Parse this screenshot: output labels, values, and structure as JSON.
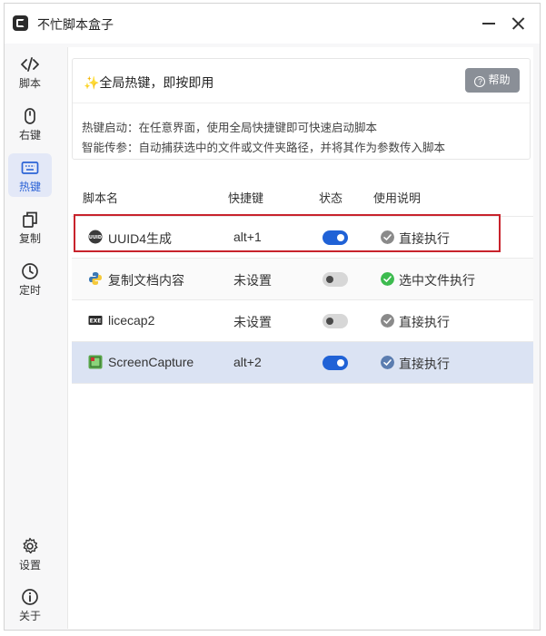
{
  "window": {
    "title": "不忙脚本盒子"
  },
  "sidebar": {
    "items": [
      {
        "label": "脚本",
        "icon": "code-icon"
      },
      {
        "label": "右键",
        "icon": "mouse-icon"
      },
      {
        "label": "热键",
        "icon": "keyboard-icon",
        "active": true
      },
      {
        "label": "复制",
        "icon": "copy-icon"
      },
      {
        "label": "定时",
        "icon": "clock-icon"
      }
    ],
    "bottom": [
      {
        "label": "设置",
        "icon": "gear-icon"
      },
      {
        "label": "关于",
        "icon": "info-icon"
      }
    ]
  },
  "info": {
    "title": "✨全局热键，即按即用",
    "help_label": "帮助",
    "line1": "热键启动：在任意界面，使用全局快捷键即可快速启动脚本",
    "line2": "智能传参：自动捕获选中的文件或文件夹路径，并将其作为参数传入脚本"
  },
  "table": {
    "headers": [
      "脚本名",
      "快捷键",
      "状态",
      "使用说明"
    ],
    "rows": [
      {
        "name": "UUID4生成",
        "hotkey": "alt+1",
        "enabled": true,
        "usage": "直接执行",
        "icon": "uuid-icon",
        "usage_color": "#8a8a8a"
      },
      {
        "name": "复制文档内容",
        "hotkey": "未设置",
        "enabled": false,
        "usage": "选中文件执行",
        "icon": "python-icon",
        "usage_color": "#3dbb4f"
      },
      {
        "name": "licecap2",
        "hotkey": "未设置",
        "enabled": false,
        "usage": "直接执行",
        "icon": "exe-icon",
        "usage_color": "#8a8a8a"
      },
      {
        "name": "ScreenCapture",
        "hotkey": "alt+2",
        "enabled": true,
        "usage": "直接执行",
        "icon": "screencapture-icon",
        "usage_color": "#5b7db0"
      }
    ]
  },
  "colors": {
    "accent": "#2062d6",
    "highlight_border": "#c8232c"
  }
}
